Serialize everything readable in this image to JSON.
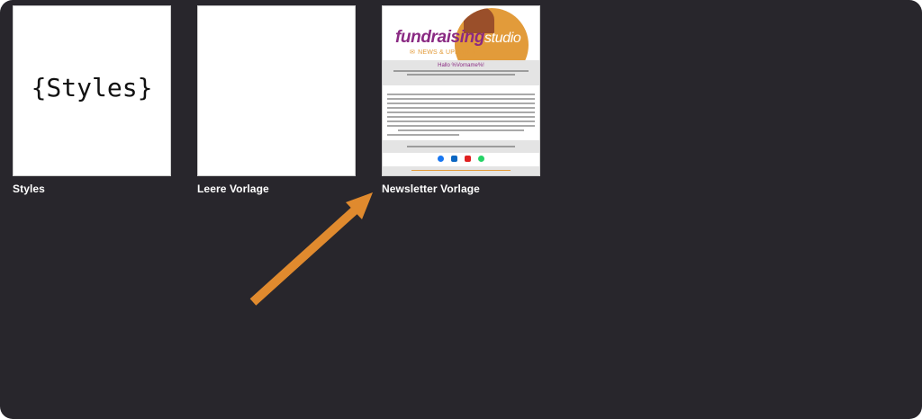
{
  "templates": [
    {
      "label": "Styles",
      "preview_text": "{Styles}"
    },
    {
      "label": "Leere Vorlage"
    },
    {
      "label": "Newsletter Vorlage",
      "preview": {
        "logo_main": "fundraising",
        "logo_accent": "studio",
        "subtitle": "NEWS & UPDATES",
        "greeting": "Hallo %Vorname%!",
        "social_icons": [
          "facebook-icon",
          "linkedin-icon",
          "youtube-icon",
          "whatsapp-icon"
        ]
      }
    }
  ],
  "colors": {
    "background": "#28262c",
    "label": "#ffffff",
    "brand_purple": "#8a2a83",
    "brand_orange": "#e29b3a",
    "arrow": "#e08a2e"
  }
}
